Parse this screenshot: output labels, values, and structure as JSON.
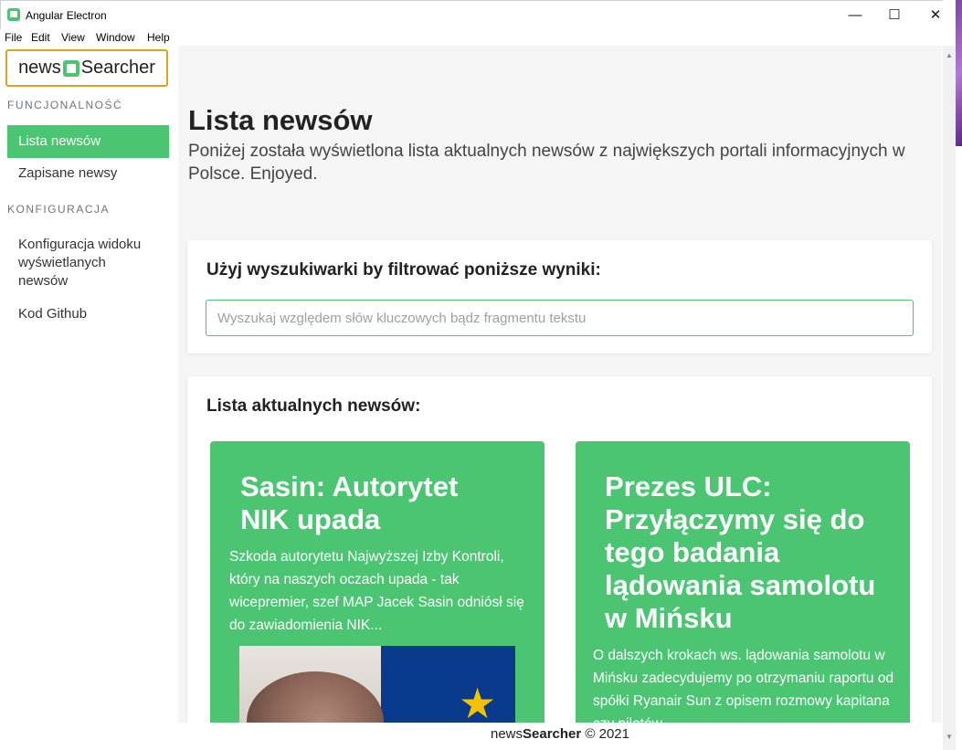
{
  "window": {
    "title": "Angular Electron",
    "min_icon": "minimize-icon",
    "max_icon": "maximize-icon",
    "close_icon": "close-icon"
  },
  "menu": [
    "File",
    "Edit",
    "View",
    "Window",
    "Help"
  ],
  "sidebar": {
    "logo": {
      "left": "news",
      "right": "Searcher"
    },
    "sections": [
      {
        "label": "FUNCJONALNOŚĆ",
        "items": [
          {
            "label": "Lista newsów",
            "active": true
          },
          {
            "label": "Zapisane newsy",
            "active": false
          }
        ]
      },
      {
        "label": "KONFIGURACJA",
        "items": [
          {
            "label": "Konfiguracja widoku wyświetlanych newsów",
            "active": false
          },
          {
            "label": "Kod Github",
            "active": false
          }
        ]
      }
    ]
  },
  "main": {
    "title": "Lista newsów",
    "subtitle": "Poniżej została wyświetlona lista aktualnych newsów z największych portali informacyjnych w Polsce. Enjoyed.",
    "search": {
      "heading": "Użyj wyszukiwarki by filtrować poniższe wyniki:",
      "placeholder": "Wyszukaj względem słów kluczowych bądz fragmentu tekstu",
      "value": ""
    },
    "news": {
      "heading": "Lista aktualnych newsów:",
      "items": [
        {
          "title": "Sasin: Autorytet NIK upada",
          "description": "Szkoda autorytetu Najwyższej Izby Kontroli, który na naszych oczach upada - tak wicepremier, szef MAP Jacek Sasin odniósł się do zawiadomienia NIK..."
        },
        {
          "title": "Prezes ULC: Przyłączymy się do tego badania lądowania samolotu w Mińsku",
          "description": "O dalszych krokach ws. lądowania samolotu w Mińsku zadecydujemy po otrzymaniu raportu od spółki Ryanair Sun z opisem rozmowy kapitana czy pilotów..."
        }
      ]
    }
  },
  "footer": {
    "left": "news",
    "brand": "Searcher",
    "copyright": "© 2021"
  },
  "colors": {
    "accent": "#4bc572",
    "logo_border": "#e0a020",
    "background": "#f5f5f5"
  }
}
